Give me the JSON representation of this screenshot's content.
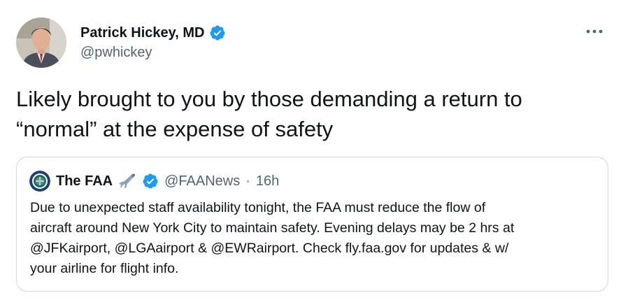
{
  "author": {
    "name": "Patrick Hickey, MD",
    "handle": "@pwhickey",
    "verified": true
  },
  "more_icon": "more-horizontal-icon",
  "tweet": {
    "lines": [
      "Likely brought to you by those demanding a return to",
      "“normal” at the expense of safety"
    ]
  },
  "quote": {
    "name": "The FAA",
    "name_emoji": "airplane-icon",
    "verified": true,
    "handle": "@FAANews",
    "separator": "·",
    "time": "16h",
    "lines": [
      "Due to unexpected staff availability tonight, the FAA must reduce the flow of",
      "aircraft around New York City to maintain safety. Evening delays may be 2 hrs at",
      "@JFKairport, @LGAairport & @EWRairport. Check fly.faa.gov for updates & w/",
      "your airline for flight info."
    ]
  },
  "colors": {
    "text": "#0f1419",
    "secondary": "#536471",
    "verified_blue": "#1d9bf0",
    "border": "#cfd9de"
  }
}
